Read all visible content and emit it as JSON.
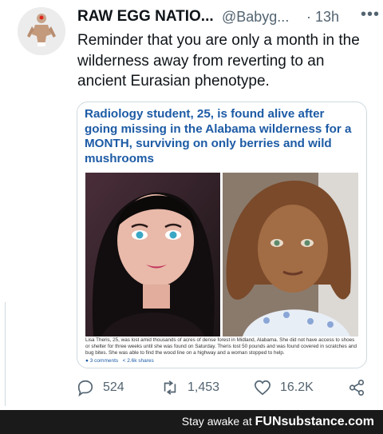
{
  "tweet": {
    "display_name": "RAW EGG NATIO...",
    "handle": "@Babyg...",
    "timestamp": "· 13h",
    "more_icon": "more-dots-icon",
    "text": "Reminder that you are only a month in the wilderness away from reverting to an ancient Eurasian phenotype."
  },
  "card": {
    "headline": "Radiology student, 25, is found alive after going missing in the Alabama wilderness for a MONTH, surviving on only berries and wild mushrooms",
    "caption": "Lisa Theris, 25, was lost amid thousands of acres of dense forest in Midland, Alabama. She did not have access to shoes or shelter for three weeks until she was found on Saturday. Theris lost 50 pounds and was found covered in scratches and bug bites. She was able to find the wood line on a highway and a woman stopped to help.",
    "comments": "3 comments",
    "shares": "2.6k shares"
  },
  "actions": {
    "reply_count": "524",
    "retweet_count": "1,453",
    "like_count": "16.2K"
  },
  "footer": {
    "prefix": "Stay awake at ",
    "brand": "FUNsubstance.com"
  },
  "colors": {
    "headline": "#1d5ba5",
    "secondary_text": "#536471",
    "footer_bg": "#1a1a1a"
  }
}
